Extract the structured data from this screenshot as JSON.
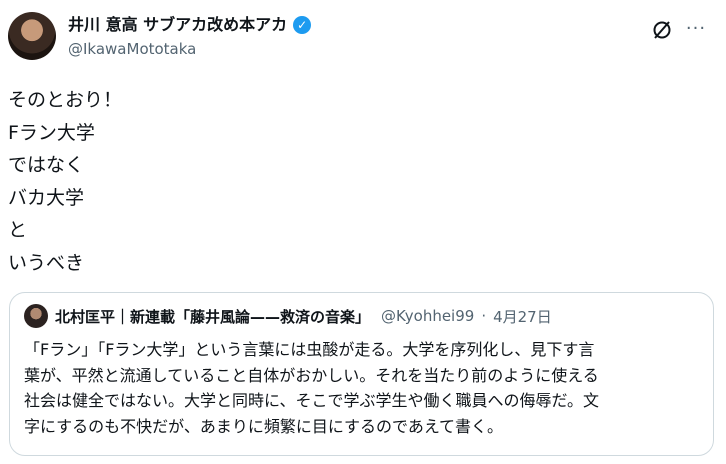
{
  "author": {
    "display_name": "井川 意高 サブアカ改め本アカ",
    "handle": "@IkawaMototaka"
  },
  "tweet": {
    "lines": [
      "そのとおり！",
      "Fラン大学",
      "ではなく",
      "バカ大学",
      "と",
      "いうべき"
    ]
  },
  "quote": {
    "display_name": "北村匡平｜新連載「藤井風論——救済の音楽」",
    "handle": "@Kyohhei99",
    "separator": "·",
    "date": "4月27日",
    "lines": [
      "「Fラン」「Fラン大学」という言葉には虫酸が走る。大学を序列化し、見下す言",
      "葉が、平然と流通していること自体がおかしい。それを当たり前のように使える",
      "社会は健全ではない。大学と同時に、そこで学ぶ学生や働く職員への侮辱だ。文",
      "字にするのも不快だが、あまりに頻繁に目にするのであえて書く。"
    ]
  },
  "icons": {
    "verified": "verified-badge-icon",
    "grok": "grok-icon",
    "more": "more-icon"
  },
  "colors": {
    "verified": "#1d9bf0",
    "secondary_text": "#536471",
    "border": "#cfd9de"
  }
}
